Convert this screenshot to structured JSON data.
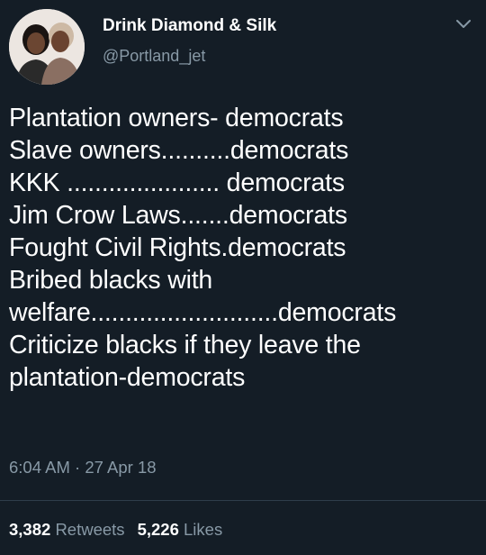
{
  "tweet": {
    "author": {
      "display_name": "Drink Diamond & Silk",
      "handle": "@Portland_jet",
      "avatar_icon": "profile-photo"
    },
    "menu_icon": "chevron-down-icon",
    "text_lines": [
      "Plantation owners- democrats",
      "Slave owners..........democrats",
      "KKK ...................... democrats",
      "Jim Crow Laws.......democrats",
      "Fought Civil Rights.democrats",
      "Bribed blacks with",
      "welfare...........................democrats",
      "Criticize blacks if they leave the",
      "plantation-democrats"
    ],
    "timestamp": "6:04 AM · 27 Apr 18",
    "stats": {
      "retweets_count": "3,382",
      "retweets_label": "Retweets",
      "likes_count": "5,226",
      "likes_label": "Likes"
    }
  },
  "colors": {
    "background": "#141d26",
    "primary_text": "#ffffff",
    "secondary_text": "#8899a6",
    "divider": "#2f3d4a"
  }
}
